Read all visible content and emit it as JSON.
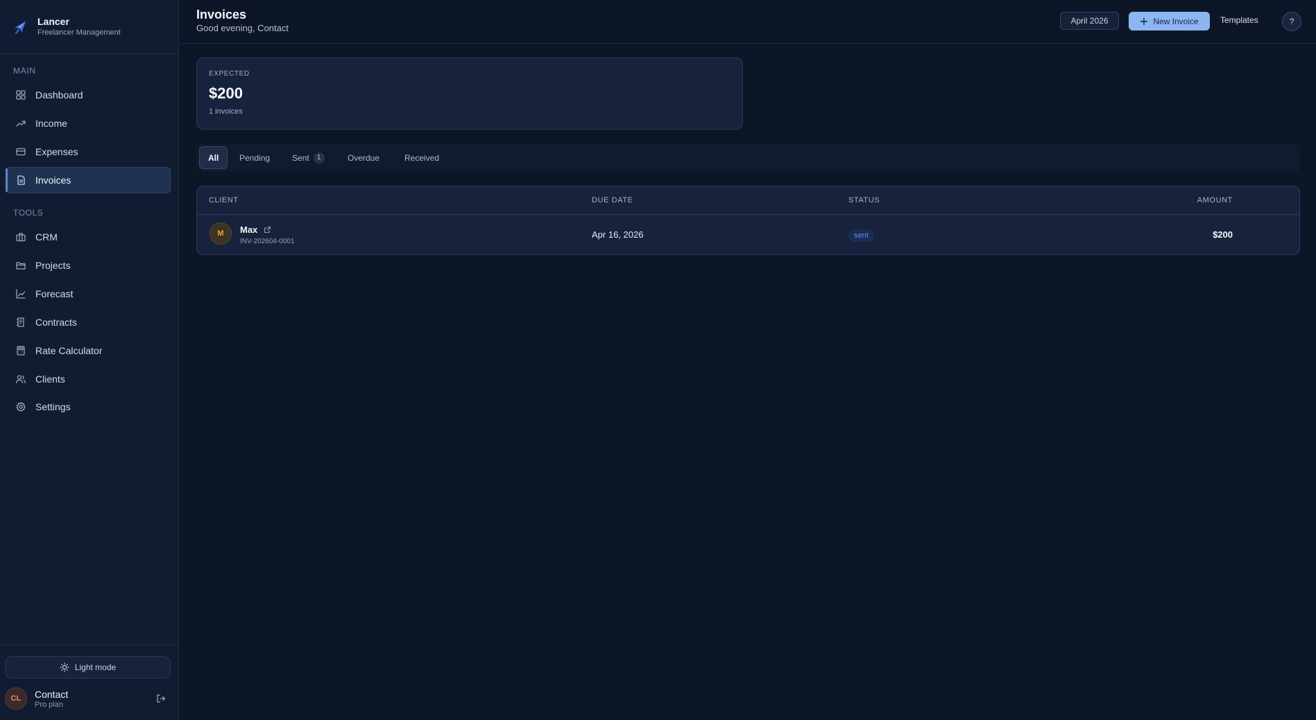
{
  "brand": {
    "name": "Lancer",
    "subtitle": "Freelancer Management"
  },
  "sidebar": {
    "main_label": "MAIN",
    "main_items": [
      {
        "label": "Dashboard",
        "icon": "grid-icon"
      },
      {
        "label": "Income",
        "icon": "trending-up-icon"
      },
      {
        "label": "Expenses",
        "icon": "credit-card-icon"
      },
      {
        "label": "Invoices",
        "icon": "document-icon",
        "active": true
      }
    ],
    "tools_label": "TOOLS",
    "tools_items": [
      {
        "label": "CRM",
        "icon": "briefcase-icon"
      },
      {
        "label": "Projects",
        "icon": "folder-icon"
      },
      {
        "label": "Forecast",
        "icon": "line-chart-icon"
      },
      {
        "label": "Contracts",
        "icon": "contract-icon"
      },
      {
        "label": "Rate Calculator",
        "icon": "calculator-icon"
      },
      {
        "label": "Clients",
        "icon": "users-icon"
      },
      {
        "label": "Settings",
        "icon": "gear-icon"
      }
    ],
    "light_mode_label": "Light mode",
    "user": {
      "initials": "CL",
      "name": "Contact",
      "plan": "Pro plan"
    }
  },
  "header": {
    "title": "Invoices",
    "greeting": "Good evening, Contact",
    "month": "April 2026",
    "new_invoice_label": "New Invoice",
    "templates_label": "Templates",
    "help_label": "?"
  },
  "expected": {
    "label": "EXPECTED",
    "value": "$200",
    "count": "1 invoices"
  },
  "tabs": [
    {
      "label": "All",
      "active": true
    },
    {
      "label": "Pending"
    },
    {
      "label": "Sent",
      "count": "1"
    },
    {
      "label": "Overdue"
    },
    {
      "label": "Received"
    }
  ],
  "table": {
    "columns": {
      "client": "CLIENT",
      "due_date": "DUE DATE",
      "status": "STATUS",
      "amount": "AMOUNT"
    },
    "rows": [
      {
        "initial": "M",
        "client": "Max",
        "invoice_id": "INV-202604-0001",
        "due_date": "Apr 16, 2026",
        "status": "sent",
        "amount": "$200"
      }
    ]
  },
  "colors": {
    "accent": "#8cb5f1",
    "status_sent": "#5d8ff2",
    "brand_logo": "#3d6fe0"
  }
}
